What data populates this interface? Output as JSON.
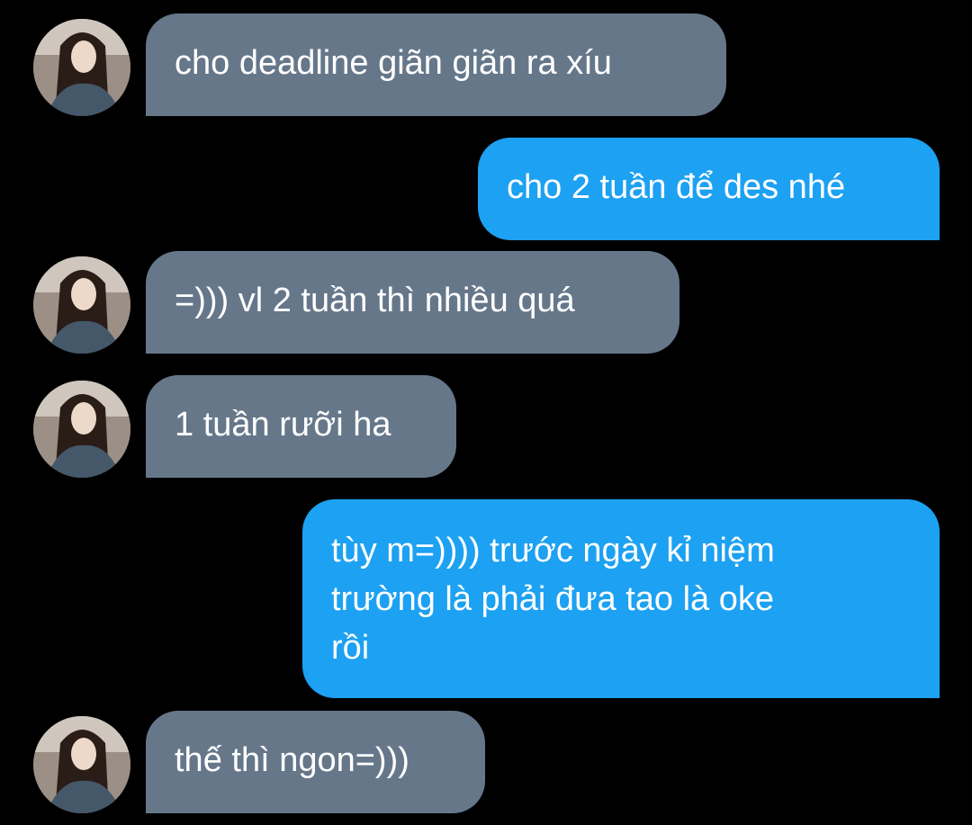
{
  "messages": [
    {
      "sender": "them",
      "text": "cho deadline giãn giãn ra xíu"
    },
    {
      "sender": "me",
      "text": "cho 2 tuần để des nhé"
    },
    {
      "sender": "them",
      "text": "=))) vl 2 tuần thì nhiều quá"
    },
    {
      "sender": "them",
      "text": "1 tuần rưỡi ha"
    },
    {
      "sender": "me",
      "text": "tùy m=)))) trước ngày kỉ niệm\ntrường là phải đưa tao là oke\nrồi"
    },
    {
      "sender": "them",
      "text": "thế thì ngon=)))"
    }
  ],
  "colors": {
    "background": "#000000",
    "incoming_bubble": "#66778a",
    "outgoing_bubble": "#1da1f2",
    "text": "#ffffff"
  },
  "icons": {
    "avatar": "profile-photo-avatar"
  }
}
